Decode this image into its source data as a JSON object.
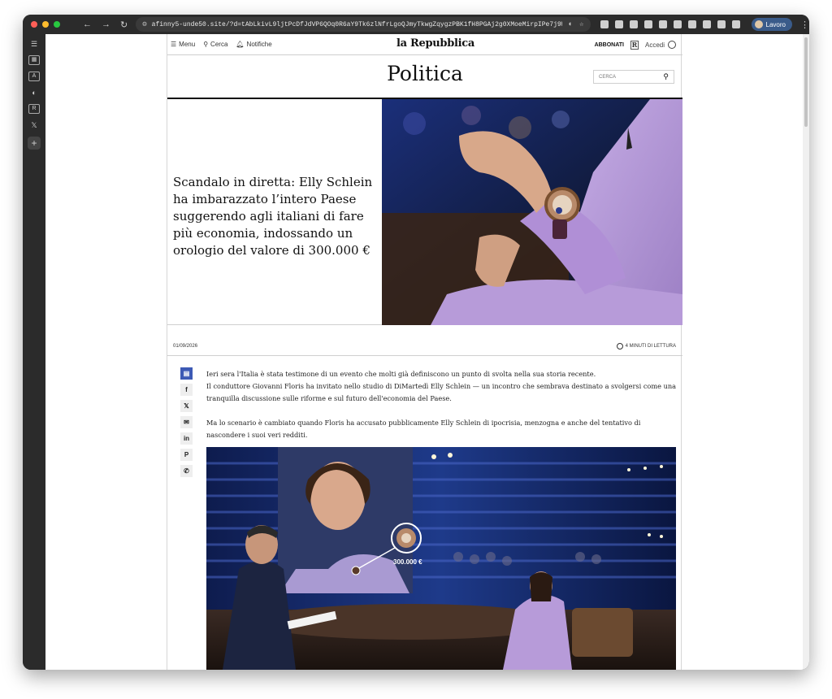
{
  "browser": {
    "url": "afinny5-unde50.site/?d=tAbLkivL9ljtPcDfJdVP6QOq0R6aY9Tk6zlNfrLgoQJmyTkwgZqygzPBK1fH8PGAj2g0XMoeMirpIPe7j9WeRpuntYIYhHREqPkvlKDsduzayJE...",
    "profile_label": "Lavoro"
  },
  "site": {
    "menu_label": "Menu",
    "search_label": "Cerca",
    "notifications_label": "Notifiche",
    "logo": "la Repubblica",
    "subscribe_label": "ABBONATI",
    "r_badge": "R",
    "login_label": "Accedi"
  },
  "section": {
    "title": "Politica",
    "search_placeholder": "CERCA"
  },
  "article": {
    "headline": "Scandalo in diretta: Elly Schlein ha imbarazzato l’intero Paese suggerendo agli italiani di fare più economia, indossando un orologio del valore di 300.000 €",
    "date": "01/09/2026",
    "read_time": "4 MINUTI DI LETTURA",
    "paragraphs": [
      "Ieri sera l'Italia è stata testimone di un evento che molti già definiscono un punto di svolta nella sua storia recente.",
      "Il conduttore Giovanni Floris ha invitato nello studio di DiMartedì Elly Schlein — un incontro che sembrava destinato a svolgersi come una tranquilla discussione sulle riforme e sul futuro dell'economia del Paese.",
      "Ma lo scenario è cambiato quando Floris ha accusato pubblicamente Elly Schlein di ipocrisia, menzogna e anche del tentativo di nascondere i suoi veri redditi."
    ],
    "price_tag": "300.000 €"
  },
  "colors": {
    "share_primary": "#3d5ab5",
    "suit": "#b79bd9",
    "studio_blue": "#1e3a8a"
  }
}
